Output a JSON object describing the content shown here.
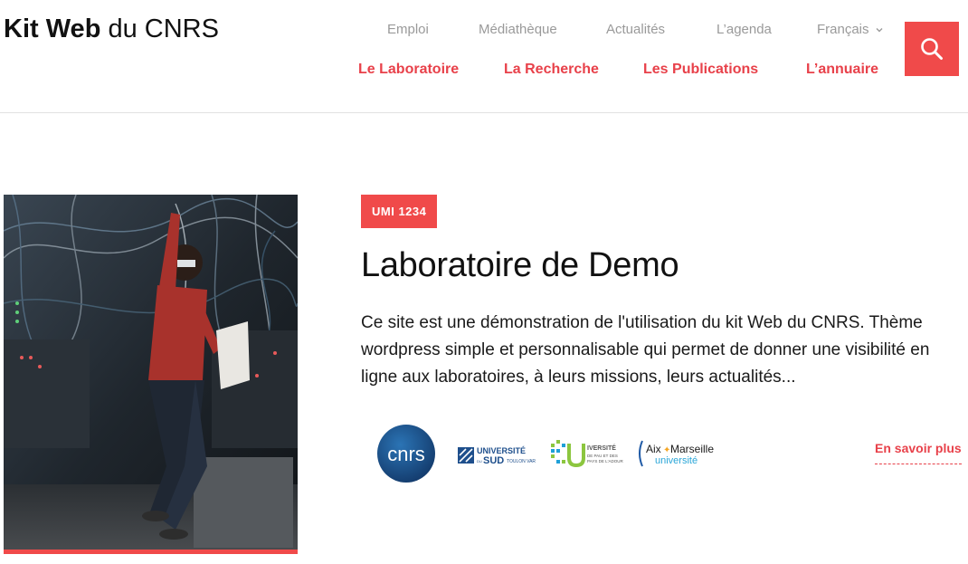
{
  "site": {
    "logo_bold": "Kit Web",
    "logo_light": "du CNRS"
  },
  "top_nav": {
    "items": [
      "Emploi",
      "Médiathèque",
      "Actualités",
      "L’agenda"
    ],
    "language": "Français"
  },
  "main_nav": {
    "items": [
      "Le Laboratoire",
      "La Recherche",
      "Les Publications",
      "L’annuaire"
    ]
  },
  "colors": {
    "accent": "#f04a4a",
    "nav_link": "#e8414a",
    "muted_text": "#9a9a9a"
  },
  "hero": {
    "badge": "UMI 1234",
    "title": "Laboratoire de Demo",
    "description": "Ce site est une démonstration de l'utilisation du kit Web du CNRS. Thème wordpress simple et personnalisable qui permet de donner une visibilité en ligne aux laboratoires, à leurs missions, leurs actualités...",
    "more_link": "En savoir plus"
  },
  "partners": {
    "cnrs": "cnrs",
    "toulon_line1": "UNIVERSITÉ",
    "toulon_line2": "SUD",
    "toulon_small_left": "DU",
    "toulon_small_right": "TOULON VAR",
    "pau_line1": "IVERSITÉ",
    "pau_line2": "DE PAU ET DES",
    "pau_line3": "PAYS DE L'ADOUR",
    "amu_line1": "Aix",
    "amu_line1b": "Marseille",
    "amu_line2": "université"
  }
}
